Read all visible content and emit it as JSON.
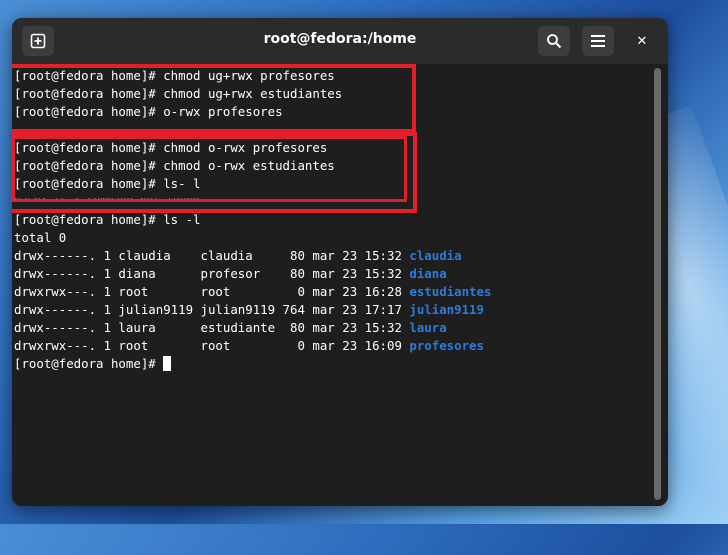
{
  "window": {
    "title": "root@fedora:/home"
  },
  "headerbar": {
    "new_tab_icon": "plus-square-icon",
    "search_icon": "search-icon",
    "menu_icon": "hamburger-menu-icon",
    "close_icon": "close-icon",
    "close_glyph": "✕"
  },
  "terminal": {
    "lines": [
      "[root@fedora home]# chmod ug+rwx profesores",
      "[root@fedora home]# chmod ug+rwx estudiantes",
      "[root@fedora home]# o-rwx profesores",
      "",
      "[root@fedora home]# chmod o-rwx profesores",
      "[root@fedora home]# chmod o-rwx estudiantes",
      "[root@fedora home]# ls- l",
      "",
      "[root@fedora home]# ls -l",
      "total 0"
    ],
    "listing": [
      {
        "meta": "drwx------. 1 claudia    claudia     80 mar 23 15:32 ",
        "name": "claudia"
      },
      {
        "meta": "drwx------. 1 diana      profesor    80 mar 23 15:32 ",
        "name": "diana"
      },
      {
        "meta": "drwxrwx---. 1 root       root         0 mar 23 16:28 ",
        "name": "estudiantes"
      },
      {
        "meta": "drwx------. 1 julian9119 julian9119 764 mar 23 17:17 ",
        "name": "julian9119"
      },
      {
        "meta": "drwx------. 1 laura      estudiante  80 mar 23 15:32 ",
        "name": "laura"
      },
      {
        "meta": "drwxrwx---. 1 root       root         0 mar 23 16:09 ",
        "name": "profesores"
      }
    ],
    "prompt": "[root@fedora home]# ",
    "garbled": "bash: ls-: command not found"
  },
  "colors": {
    "terminal_bg": "#1e1e1e",
    "directory": "#2a7bde",
    "highlight_box": "#e3202a"
  }
}
